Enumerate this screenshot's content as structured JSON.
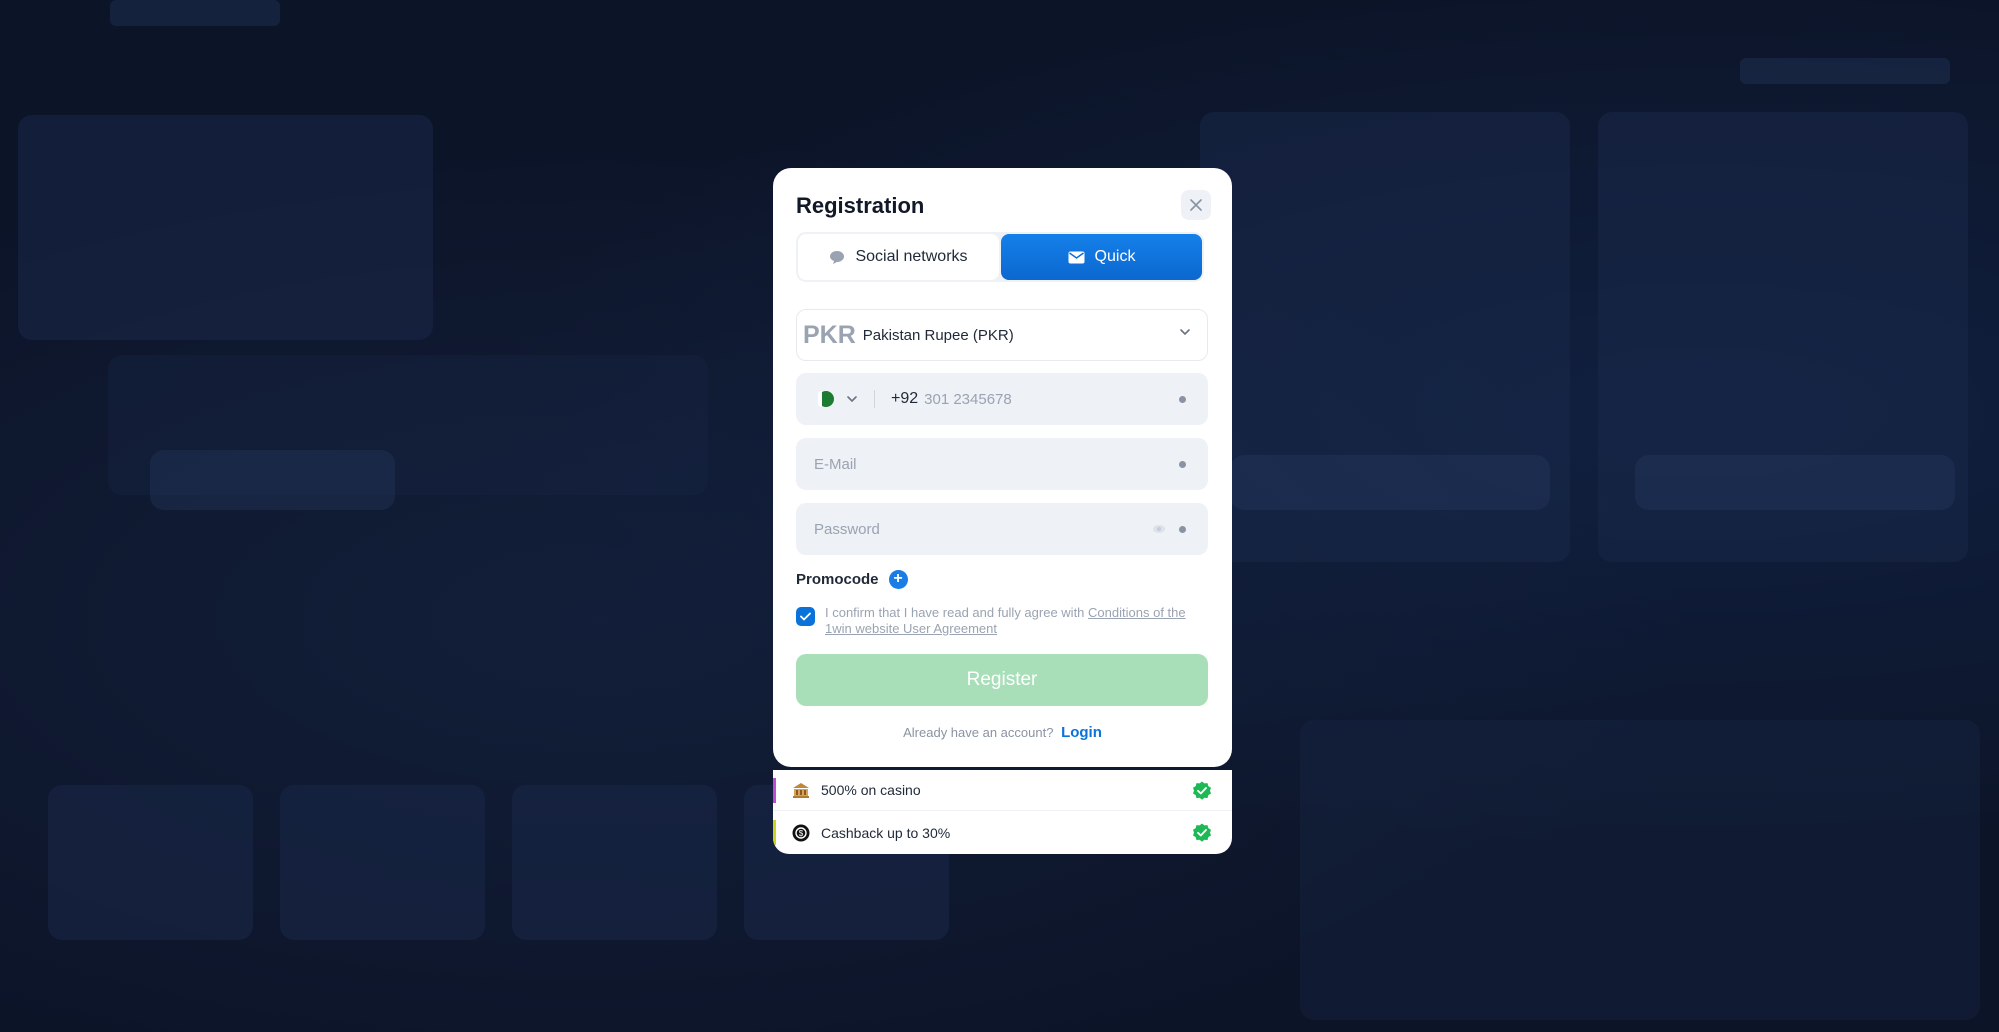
{
  "modal": {
    "title": "Registration",
    "tabs": [
      {
        "label": "Social networks",
        "active": false
      },
      {
        "label": "Quick",
        "active": true
      }
    ],
    "currency": {
      "code": "PKR",
      "name": "Pakistan Rupee (PKR)"
    },
    "phone": {
      "prefix": "+92",
      "placeholder": "301 2345678"
    },
    "email": {
      "placeholder": "E-Mail"
    },
    "password": {
      "placeholder": "Password"
    },
    "promocode_label": "Promocode",
    "agreement": {
      "text": "I confirm that I have read and fully agree with",
      "link": "Conditions of the 1win website User Agreement",
      "checked": true
    },
    "register_label": "Register",
    "login_prompt": "Already have an account?",
    "login_link": "Login"
  },
  "bonuses": [
    {
      "label": "500% on casino",
      "icon": "casino-icon",
      "accent": "#c24bd6"
    },
    {
      "label": "Cashback up to 30%",
      "icon": "cashback-icon",
      "accent": "#c9d61f"
    }
  ],
  "colors": {
    "primary": "#0b72d9",
    "register_disabled": "#a8dfb9",
    "success": "#1db954",
    "overlay": "#0c1428"
  }
}
